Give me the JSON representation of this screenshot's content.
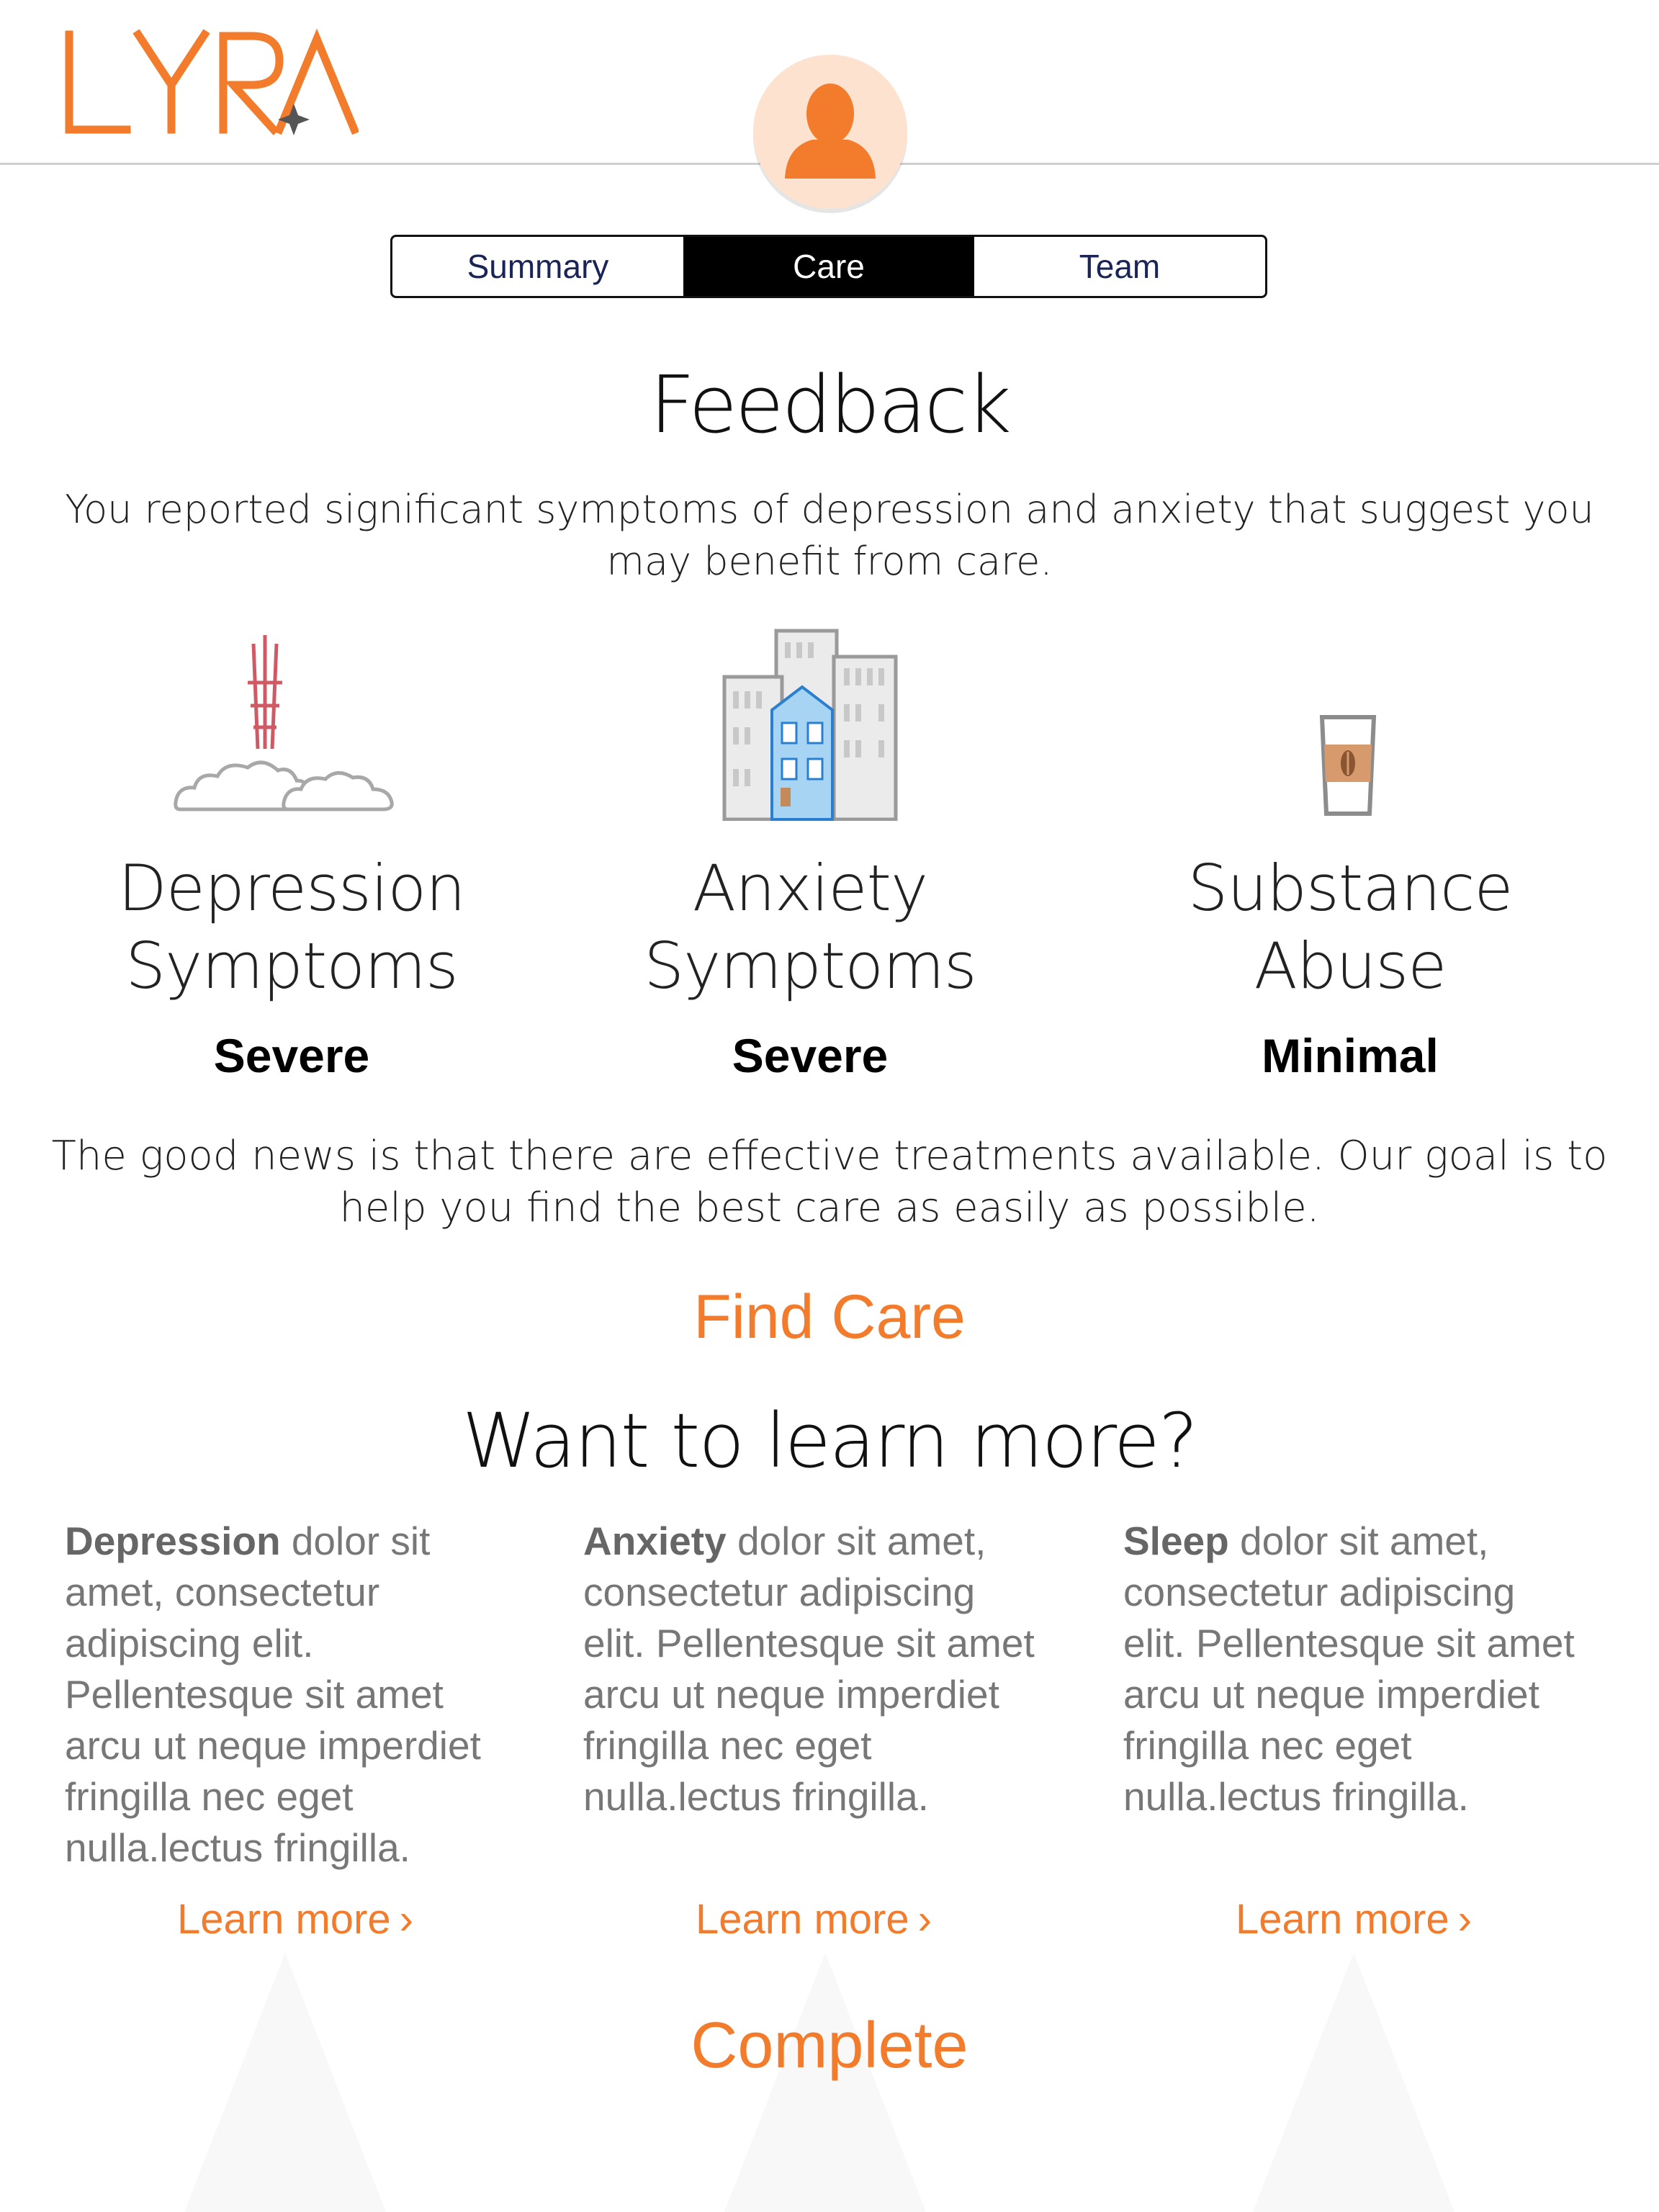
{
  "header": {
    "logo_text": "LYRA",
    "logo_color": "#f27b2c"
  },
  "tabs": [
    {
      "label": "Summary",
      "active": false
    },
    {
      "label": "Care",
      "active": true
    },
    {
      "label": "Team",
      "active": false
    }
  ],
  "feedback": {
    "title": "Feedback",
    "text": "You reported significant symptoms of depression and anxiety that suggest you may benefit from care."
  },
  "categories": [
    {
      "name_line1": "Depression",
      "name_line2": "Symptoms",
      "level": "Severe",
      "icon": "tower-clouds-icon"
    },
    {
      "name_line1": "Anxiety",
      "name_line2": "Symptoms",
      "level": "Severe",
      "icon": "city-buildings-icon"
    },
    {
      "name_line1": "Substance",
      "name_line2": "Abuse",
      "level": "Minimal",
      "icon": "coffee-cup-icon"
    }
  ],
  "good_news": "The good news is that there are effective treatments available. Our goal is to help you find the best care as easily as possible.",
  "find_care_label": "Find Care",
  "learn_more": {
    "title": "Want to learn more?",
    "items": [
      {
        "heading": "Depression",
        "body": " dolor sit amet, consectetur adipiscing elit. Pellentesque sit amet arcu ut neque imperdiet fringilla nec eget nulla.lectus fringilla.",
        "link": "Learn more"
      },
      {
        "heading": "Anxiety",
        "body": " dolor sit amet, consectetur adipiscing elit. Pellentesque sit amet arcu ut neque imperdiet fringilla nec eget nulla.lectus fringilla.",
        "link": "Learn more"
      },
      {
        "heading": "Sleep",
        "body": " dolor sit amet, consectetur adipiscing elit. Pellentesque sit amet arcu ut neque imperdiet fringilla nec eget nulla.lectus fringilla.",
        "link": "Learn more"
      }
    ]
  },
  "complete_label": "Complete",
  "colors": {
    "accent": "#f27b2c",
    "avatar_bg": "#fde3cf",
    "tab_active": "#000000"
  }
}
